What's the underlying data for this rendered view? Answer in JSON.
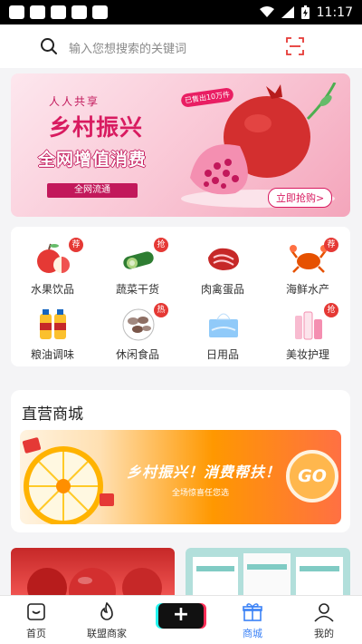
{
  "status_bar": {
    "time": "11:17"
  },
  "search": {
    "placeholder": "输入您想搜索的关键词"
  },
  "banner": {
    "tagline": "人人共享",
    "title": "乡村振兴",
    "subtitle": "全网增值消费",
    "pill": "全网流通",
    "badge": "已售出10万件",
    "button": "立即抢购>"
  },
  "categories": [
    {
      "label": "水果饮品",
      "tag": "荐"
    },
    {
      "label": "蔬菜干货",
      "tag": "抢"
    },
    {
      "label": "肉禽蛋品",
      "tag": ""
    },
    {
      "label": "海鲜水产",
      "tag": "荐"
    },
    {
      "label": "粮油调味",
      "tag": ""
    },
    {
      "label": "休闲食品",
      "tag": "热"
    },
    {
      "label": "日用品",
      "tag": ""
    },
    {
      "label": "美妆护理",
      "tag": "抢"
    }
  ],
  "mall": {
    "title": "直营商城",
    "slogan": "乡村振兴！消费帮扶！",
    "subtext": "全场惊喜任您选",
    "go": "GO"
  },
  "bottom_nav": [
    {
      "label": "首页",
      "icon": "home-icon"
    },
    {
      "label": "联盟商家",
      "icon": "fire-icon"
    },
    {
      "label": "",
      "icon": "plus-icon"
    },
    {
      "label": "商城",
      "icon": "gift-icon"
    },
    {
      "label": "我的",
      "icon": "person-icon"
    }
  ],
  "colors": {
    "accent": "#d81b60",
    "nav_active": "#3b82f6",
    "tag_red": "#e53935"
  }
}
